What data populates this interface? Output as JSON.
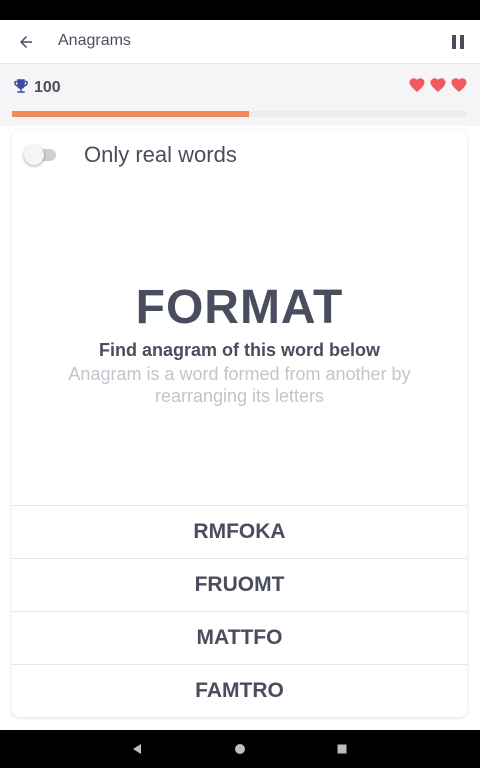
{
  "app_bar": {
    "title": "Anagrams",
    "back_icon": "arrow-left-icon",
    "pause_icon": "pause-icon"
  },
  "stats": {
    "score": "100",
    "trophy_icon": "trophy-icon",
    "lives": 3,
    "progress_fraction": 0.52,
    "colors": {
      "progress": "#f08a5d",
      "heart": "#f05a5f",
      "trophy": "#3f4aa8"
    }
  },
  "toggle": {
    "label": "Only real words",
    "enabled": false
  },
  "puzzle": {
    "word": "FORMAT",
    "instruction": "Find anagram of this word below",
    "hint": "Anagram is a word formed from another by rearranging its letters"
  },
  "options": [
    "RMFOKA",
    "FRUOMT",
    "MATTFO",
    "FAMTRO"
  ],
  "nav_bar": {
    "back": "nav-back-icon",
    "home": "nav-home-icon",
    "recents": "nav-recents-icon"
  }
}
